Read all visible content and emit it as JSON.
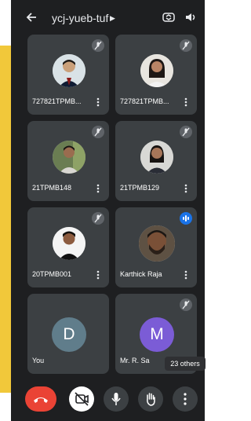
{
  "meeting": {
    "code": "ycj-yueb-tuf"
  },
  "participants": [
    {
      "name": "727821TPMB..."
    },
    {
      "name": "727821TPMB..."
    },
    {
      "name": "21TPMB148"
    },
    {
      "name": "21TPMB129"
    },
    {
      "name": "20TPMB001"
    },
    {
      "name": "Karthick Raja"
    },
    {
      "name": "You",
      "initial": "D"
    },
    {
      "name": "Mr. R. Sa",
      "initial": "M"
    }
  ],
  "others_badge": "23 others",
  "colors": {
    "panel": "#3c4043",
    "end_call": "#ea4335",
    "avatar_you": "#607d8b",
    "avatar_m": "#7b5cd6",
    "accent": "#f1c83a",
    "speaking": "#1a73e8"
  }
}
